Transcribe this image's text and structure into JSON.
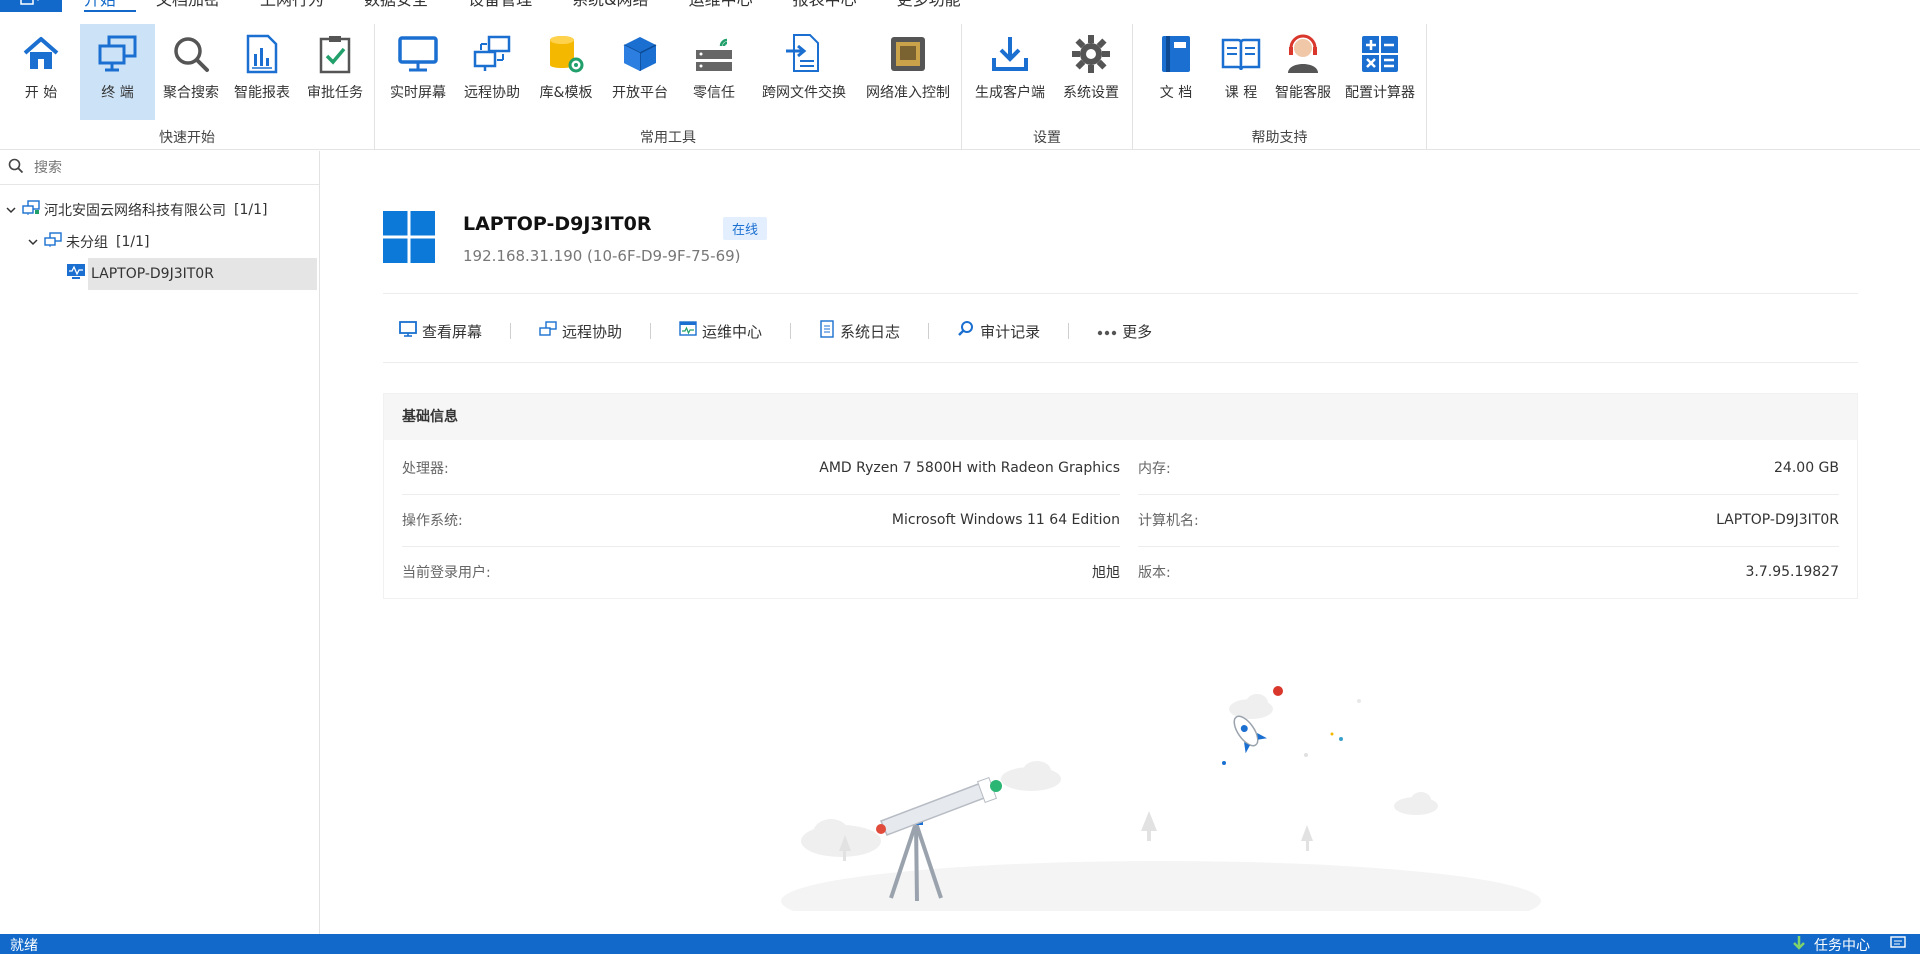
{
  "menu": {
    "tabs": [
      "开始",
      "文档加密",
      "上网行为",
      "数据安全",
      "设备管理",
      "系统&网络",
      "运维中心",
      "报表中心",
      "更多功能"
    ]
  },
  "ribbon": {
    "groups": {
      "quick": {
        "title": "快速开始",
        "items": [
          "开 始",
          "终 端",
          "聚合搜索",
          "智能报表",
          "审批任务"
        ]
      },
      "tools": {
        "title": "常用工具",
        "items": [
          "实时屏幕",
          "远程协助",
          "库&模板",
          "开放平台",
          "零信任",
          "跨网文件交换",
          "网络准入控制"
        ]
      },
      "settings": {
        "title": "设置",
        "items": [
          "生成客户端",
          "系统设置"
        ]
      },
      "help": {
        "title": "帮助支持",
        "items": [
          "文 档",
          "课 程",
          "智能客服",
          "配置计算器"
        ]
      }
    }
  },
  "sidebar": {
    "search_placeholder": "搜索",
    "tree": {
      "company": "河北安固云网络科技有限公司",
      "company_count": "[1/1]",
      "group": "未分组",
      "group_count": "[1/1]",
      "device": "LAPTOP-D9J3IT0R"
    }
  },
  "device": {
    "name": "LAPTOP-D9J3IT0R",
    "status": "在线",
    "ip": "192.168.31.190  (10-6F-D9-9F-75-69)"
  },
  "actions": [
    "查看屏幕",
    "远程协助",
    "运维中心",
    "系统日志",
    "审计记录",
    "更多"
  ],
  "info": {
    "title": "基础信息",
    "rows": [
      {
        "label": "处理器:",
        "value": "AMD Ryzen 7 5800H with Radeon Graphics"
      },
      {
        "label": "内存:",
        "value": "24.00 GB"
      },
      {
        "label": "操作系统:",
        "value": "Microsoft Windows 11  64 Edition"
      },
      {
        "label": "计算机名:",
        "value": "LAPTOP-D9J3IT0R"
      },
      {
        "label": "当前登录用户:",
        "value": "旭旭"
      },
      {
        "label": "版本:",
        "value": "3.7.95.19827"
      }
    ]
  },
  "status": {
    "left": "就绪",
    "task_center": "任务中心"
  },
  "colors": {
    "accent": "#1269c9",
    "selected_bg": "#cce3f7",
    "online_badge": "#1a6fd0"
  }
}
